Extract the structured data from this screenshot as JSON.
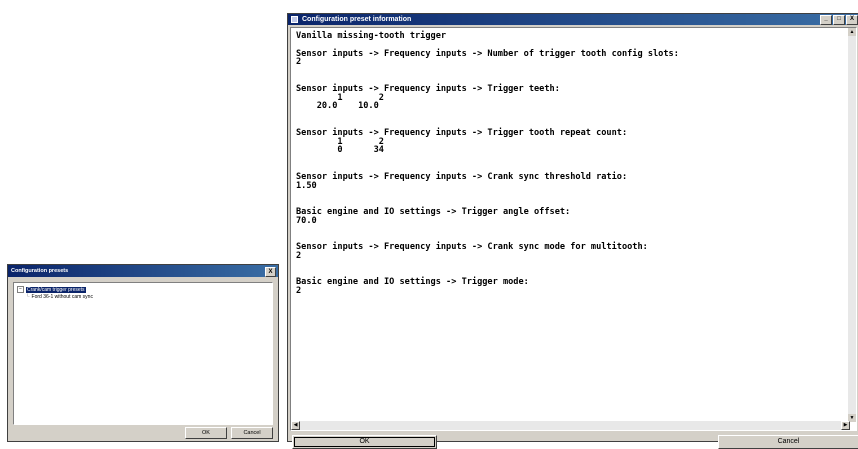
{
  "presets_dialog": {
    "title": "Configuration presets",
    "close_glyph": "X",
    "tree": {
      "root_toggle": "−",
      "root_label": "Crank/cam trigger presets",
      "children": [
        "Ford 36-1 without cam sync"
      ]
    },
    "ok_label": "OK",
    "cancel_label": "Cancel"
  },
  "info_window": {
    "title": "Configuration preset information",
    "content": "Vanilla missing-tooth trigger\n\nSensor inputs -> Frequency inputs -> Number of trigger tooth config slots:\n2\n\n\nSensor inputs -> Frequency inputs -> Trigger teeth:\n        1       2\n    20.0    10.0\n\n\nSensor inputs -> Frequency inputs -> Trigger tooth repeat count:\n        1       2\n        0      34\n\n\nSensor inputs -> Frequency inputs -> Crank sync threshold ratio:\n1.50\n\n\nBasic engine and IO settings -> Trigger angle offset:\n70.0\n\n\nSensor inputs -> Frequency inputs -> Crank sync mode for multitooth:\n2\n\n\nBasic engine and IO settings -> Trigger mode:\n2",
    "ok_label": "OK",
    "cancel_label": "Cancel",
    "minimize_glyph": "_",
    "maximize_glyph": "□",
    "close_glyph": "X"
  }
}
